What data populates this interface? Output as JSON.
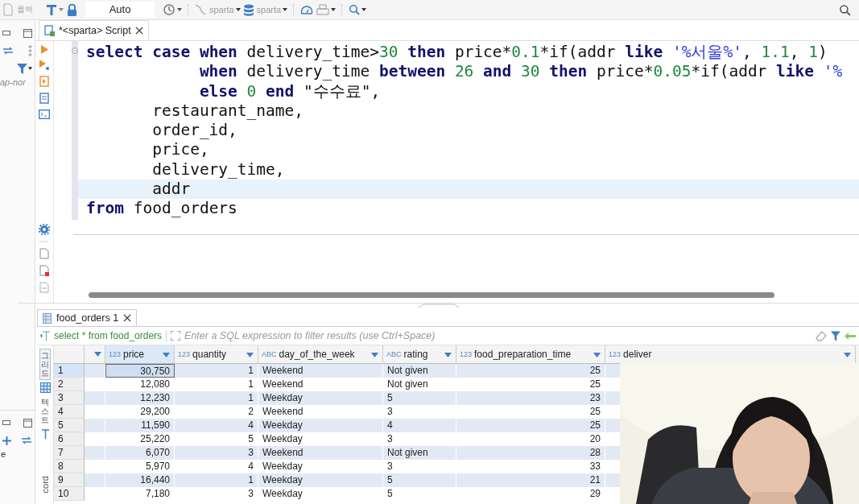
{
  "toolbar": {
    "commit_label": "롤백",
    "mode": "Auto",
    "connection": "sparta",
    "database": "sparta"
  },
  "navigator": {
    "filter_text": "ap-nor",
    "lower_text": "e"
  },
  "editor_tab": {
    "title": "*<sparta> Script"
  },
  "code_lines": [
    {
      "current": false,
      "tokens": [
        {
          "kind": "keyword",
          "t": "select "
        },
        {
          "kind": "keyword",
          "t": "case "
        },
        {
          "kind": "keyword",
          "t": "when"
        },
        {
          "kind": "plain",
          "t": " delivery_time>"
        },
        {
          "kind": "number",
          "t": "30"
        },
        {
          "kind": "keyword",
          "t": " then"
        },
        {
          "kind": "plain",
          "t": " price*"
        },
        {
          "kind": "number",
          "t": "0.1"
        },
        {
          "kind": "plain",
          "t": "*if(addr "
        },
        {
          "kind": "keyword",
          "t": "like"
        },
        {
          "kind": "string",
          "t": " '%서울%'"
        },
        {
          "kind": "plain",
          "t": ", "
        },
        {
          "kind": "number",
          "t": "1.1"
        },
        {
          "kind": "plain",
          "t": ", "
        },
        {
          "kind": "number",
          "t": "1"
        },
        {
          "kind": "plain",
          "t": ")"
        }
      ]
    },
    {
      "current": false,
      "tokens": [
        {
          "kind": "keyword",
          "t": "            when"
        },
        {
          "kind": "plain",
          "t": " delivery_time "
        },
        {
          "kind": "keyword",
          "t": "between"
        },
        {
          "kind": "number",
          "t": " 26"
        },
        {
          "kind": "keyword",
          "t": " and"
        },
        {
          "kind": "number",
          "t": " 30"
        },
        {
          "kind": "keyword",
          "t": " then"
        },
        {
          "kind": "plain",
          "t": " price*"
        },
        {
          "kind": "number",
          "t": "0.05"
        },
        {
          "kind": "plain",
          "t": "*if(addr "
        },
        {
          "kind": "keyword",
          "t": "like"
        },
        {
          "kind": "string",
          "t": " '%"
        }
      ]
    },
    {
      "current": false,
      "tokens": [
        {
          "kind": "keyword",
          "t": "            else"
        },
        {
          "kind": "number",
          "t": " 0"
        },
        {
          "kind": "keyword",
          "t": " end"
        },
        {
          "kind": "plain",
          "t": " \"수수료\","
        }
      ]
    },
    {
      "current": false,
      "tokens": [
        {
          "kind": "plain",
          "t": "       restaurant_name,"
        }
      ]
    },
    {
      "current": false,
      "tokens": [
        {
          "kind": "plain",
          "t": "       order_id,"
        }
      ]
    },
    {
      "current": false,
      "tokens": [
        {
          "kind": "plain",
          "t": "       price,"
        }
      ]
    },
    {
      "current": false,
      "tokens": [
        {
          "kind": "plain",
          "t": "       delivery_time,"
        }
      ]
    },
    {
      "current": true,
      "tokens": [
        {
          "kind": "plain",
          "t": "       addr"
        }
      ]
    },
    {
      "current": false,
      "tokens": [
        {
          "kind": "keyword",
          "t": "from"
        },
        {
          "kind": "plain",
          "t": " food_orders"
        }
      ]
    }
  ],
  "results_tab": {
    "title": "food_orders 1"
  },
  "filter": {
    "query": "select * from food_orders",
    "placeholder": "Enter a SQL expression to filter results (use Ctrl+Space)"
  },
  "side_tabs": [
    {
      "label": "그리드",
      "selected": true
    },
    {
      "label": "텍스트",
      "selected": false
    },
    {
      "label": "cord",
      "selected": false
    }
  ],
  "table": {
    "columns": [
      {
        "type": "123",
        "name": "price",
        "selected": true
      },
      {
        "type": "123",
        "name": "quantity",
        "selected": false
      },
      {
        "type": "ABC",
        "name": "day_of_the_week",
        "selected": false
      },
      {
        "type": "ABC",
        "name": "rating",
        "selected": false
      },
      {
        "type": "123",
        "name": "food_preparation_time",
        "selected": false
      },
      {
        "type": "123",
        "name": "deliver",
        "selected": false
      }
    ],
    "rows": [
      {
        "num": "1",
        "selected": true,
        "cells": [
          "30,750",
          "1",
          "Weekend",
          "Not given",
          "25"
        ]
      },
      {
        "num": "2",
        "selected": false,
        "cells": [
          "12,080",
          "1",
          "Weekend",
          "Not given",
          "25"
        ]
      },
      {
        "num": "3",
        "selected": false,
        "cells": [
          "12,230",
          "1",
          "Weekday",
          "5",
          "23"
        ]
      },
      {
        "num": "4",
        "selected": false,
        "cells": [
          "29,200",
          "2",
          "Weekend",
          "3",
          "25"
        ]
      },
      {
        "num": "5",
        "selected": false,
        "cells": [
          "11,590",
          "4",
          "Weekday",
          "4",
          "25"
        ]
      },
      {
        "num": "6",
        "selected": false,
        "cells": [
          "25,220",
          "5",
          "Weekday",
          "3",
          "20"
        ]
      },
      {
        "num": "7",
        "selected": false,
        "cells": [
          "6,070",
          "3",
          "Weekend",
          "Not given",
          "28"
        ]
      },
      {
        "num": "8",
        "selected": false,
        "cells": [
          "5,970",
          "4",
          "Weekday",
          "3",
          "33"
        ]
      },
      {
        "num": "9",
        "selected": false,
        "cells": [
          "16,440",
          "1",
          "Weekday",
          "5",
          "21"
        ]
      },
      {
        "num": "10",
        "selected": false,
        "cells": [
          "7,180",
          "3",
          "Weekday",
          "5",
          "29"
        ]
      }
    ]
  }
}
